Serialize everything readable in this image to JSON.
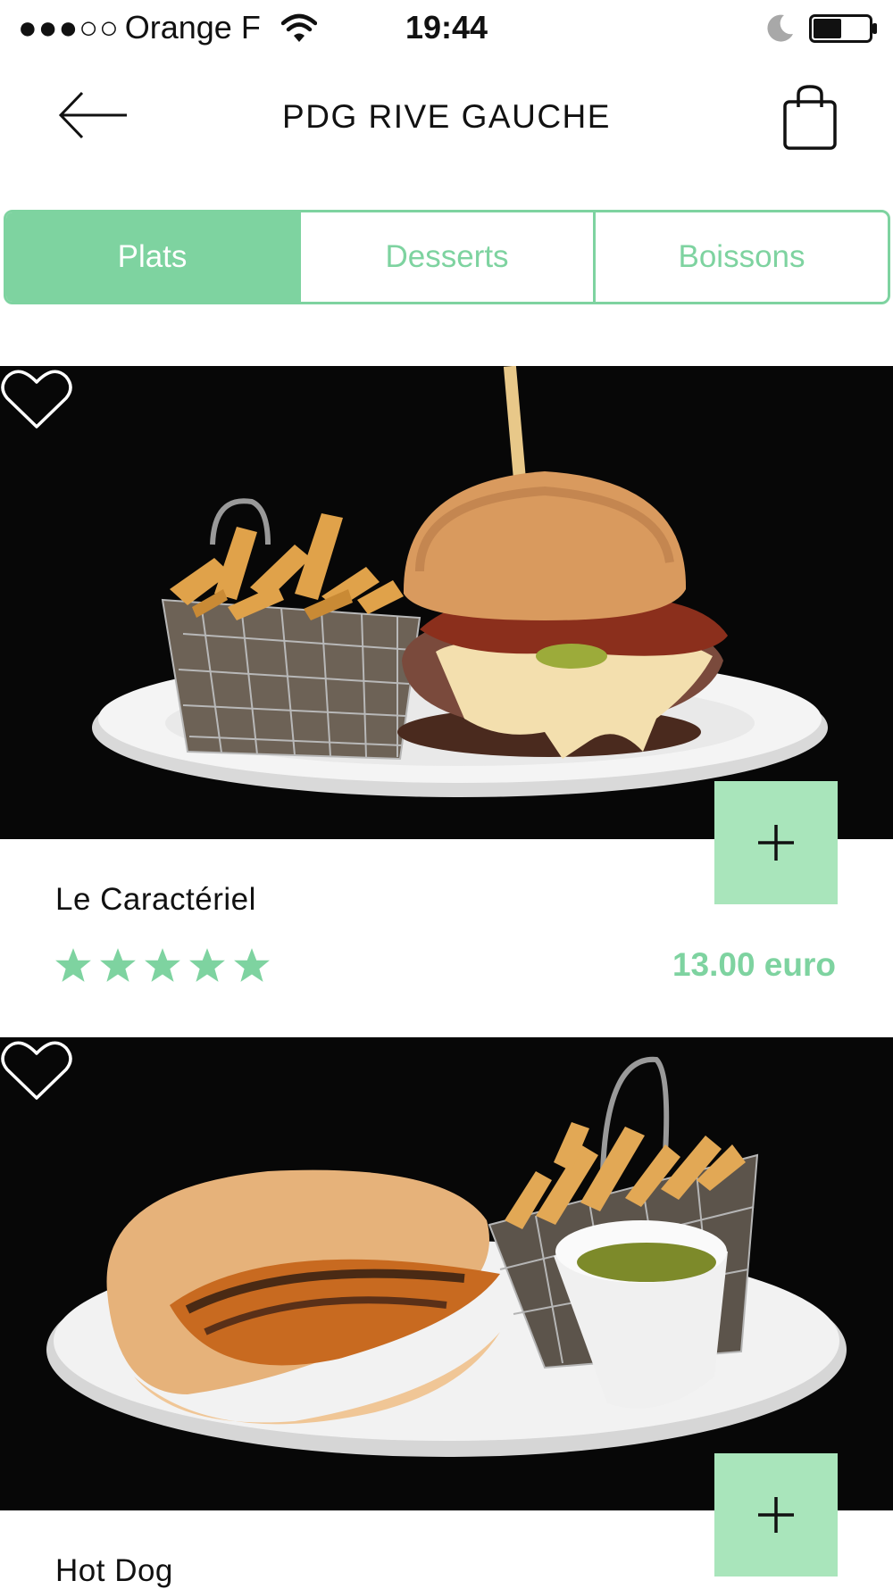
{
  "status_bar": {
    "signal_dots": "●●●○○",
    "carrier": "Orange F",
    "time": "19:44",
    "wifi_icon": "wifi-icon",
    "moon_icon": "moon-icon",
    "battery_icon": "battery-icon",
    "battery_level": 0.5
  },
  "header": {
    "title": "PDG RIVE GAUCHE",
    "back_icon": "arrow-left-icon",
    "bag_icon": "shopping-bag-icon"
  },
  "tabs": [
    {
      "label": "Plats",
      "active": true
    },
    {
      "label": "Desserts",
      "active": false
    },
    {
      "label": "Boissons",
      "active": false
    }
  ],
  "products": [
    {
      "name": "Le Caractériel",
      "rating": 5,
      "rating_max": 5,
      "price": "13.00 euro",
      "favorite": false,
      "image": "burger-and-fries-photo"
    },
    {
      "name": "Hot Dog",
      "image": "hotdog-and-fries-photo",
      "favorite": false
    }
  ],
  "colors": {
    "accent": "#7ed3a0",
    "add_button": "#a9e5bb",
    "photo_bg": "#070707"
  }
}
